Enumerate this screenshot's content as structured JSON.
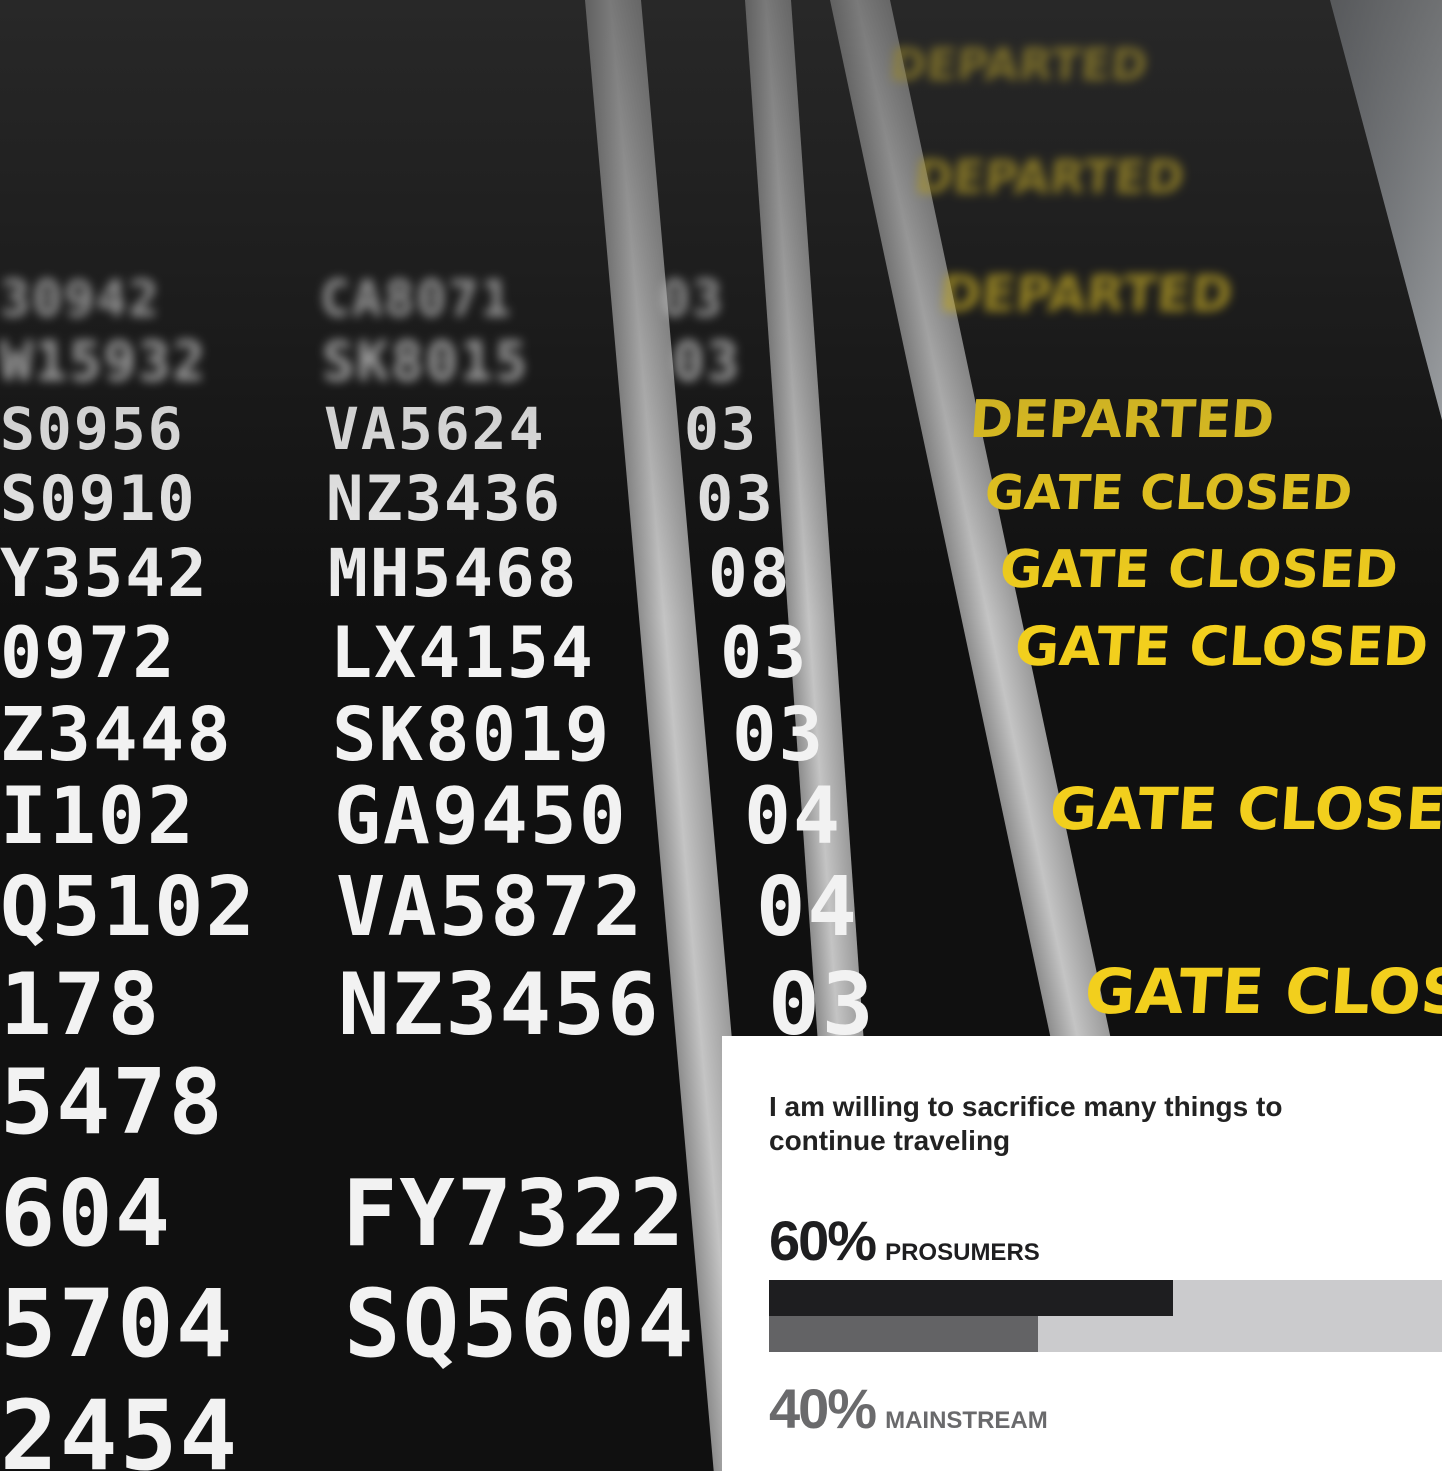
{
  "photo": {
    "rows": [
      {
        "a": "30942",
        "b": "CA8071",
        "c": "03"
      },
      {
        "a": "W15932",
        "b": "SK8015",
        "c": "03"
      },
      {
        "a": "S0956",
        "b": "VA5624",
        "c": "03"
      },
      {
        "a": "S0910",
        "b": "NZ3436",
        "c": "03"
      },
      {
        "a": "Y3542",
        "b": "MH5468",
        "c": "08"
      },
      {
        "a": "0972",
        "b": "LX4154",
        "c": "03"
      },
      {
        "a": "Z3448",
        "b": "SK8019",
        "c": "03"
      },
      {
        "a": "I102",
        "b": "GA9450",
        "c": "04"
      },
      {
        "a": "Q5102",
        "b": "VA5872",
        "c": "04"
      },
      {
        "a": "178",
        "b": "NZ3456",
        "c": "03"
      },
      {
        "a": "5478",
        "b": "",
        "c": ""
      },
      {
        "a": "604",
        "b": "FY7322",
        "c": ""
      },
      {
        "a": "5704",
        "b": "SQ5604",
        "c": ""
      },
      {
        "a": "2454",
        "b": "",
        "c": ""
      }
    ],
    "statuses": [
      {
        "text": "DEPARTED"
      },
      {
        "text": "DEPARTED"
      },
      {
        "text": "DEPARTED"
      },
      {
        "text": "DEPARTED"
      },
      {
        "text": "GATE CLOSED"
      },
      {
        "text": "GATE CLOSED"
      },
      {
        "text": "GATE CLOSED"
      },
      {
        "text": "GATE CLOSED"
      },
      {
        "text": "GATE CLOSIN"
      }
    ]
  },
  "card": {
    "question": "I am willing to sacrifice many things to continue traveling"
  },
  "chart_data": {
    "type": "bar",
    "title": "I am willing to sacrifice many things to continue traveling",
    "unit": "%",
    "ylim": [
      0,
      100
    ],
    "series": [
      {
        "name": "PROSUMERS",
        "value": 60,
        "label": "60%",
        "color": "#1e1e20"
      },
      {
        "name": "MAINSTREAM",
        "value": 40,
        "label": "40%",
        "color": "#636365"
      }
    ],
    "track_color": "#cbcbcd"
  }
}
